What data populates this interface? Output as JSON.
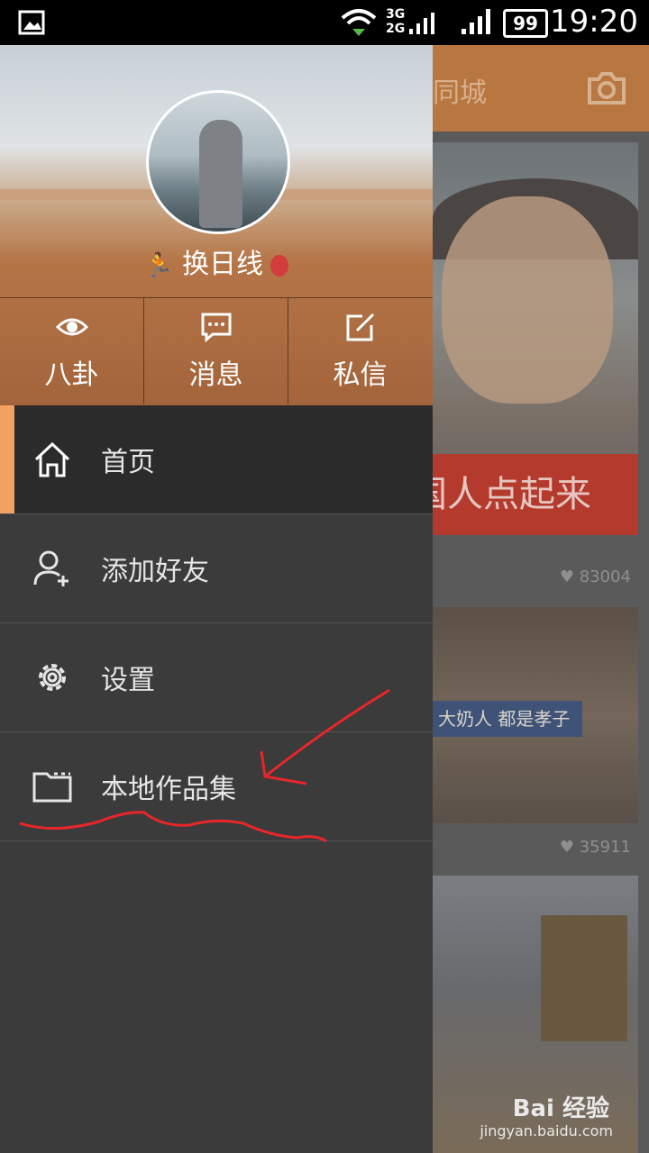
{
  "status_bar": {
    "time": "19:20",
    "battery": "99",
    "network_top": "3G",
    "network_bottom": "2G"
  },
  "background": {
    "header_title": "同城",
    "card1_banner": "国人点起来",
    "card1_likes": "83004",
    "card2_caption": "大奶人 都是孝子",
    "card2_likes": "35911",
    "watermark": "Bai 经验",
    "watermark_url": "jingyan.baidu.com"
  },
  "drawer": {
    "username": "换日线",
    "actions": [
      {
        "label": "八卦",
        "icon": "eye-icon"
      },
      {
        "label": "消息",
        "icon": "message-icon"
      },
      {
        "label": "私信",
        "icon": "edit-icon"
      }
    ],
    "menu": [
      {
        "label": "首页",
        "icon": "home-icon",
        "active": true
      },
      {
        "label": "添加好友",
        "icon": "add-user-icon",
        "active": false
      },
      {
        "label": "设置",
        "icon": "gear-icon",
        "active": false
      },
      {
        "label": "本地作品集",
        "icon": "folder-icon",
        "active": false
      }
    ]
  },
  "colors": {
    "accent": "#f3a063",
    "drawer_bg": "#3b3b3b",
    "active_bg": "#2b2b2b",
    "annotation": "#e8262a"
  }
}
